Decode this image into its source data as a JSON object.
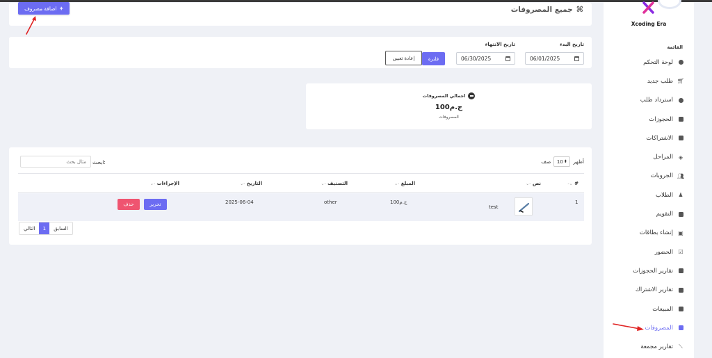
{
  "sidebar": {
    "brand_name": "Xcoding Era",
    "menu_title": "القائمة",
    "items": [
      {
        "label": "لوحة التحكم",
        "icon": "dashboard-icon"
      },
      {
        "label": "طلب جديد",
        "icon": "cart-icon"
      },
      {
        "label": "استرداد طلب",
        "icon": "refund-icon"
      },
      {
        "label": "الحجوزات",
        "icon": "book-icon"
      },
      {
        "label": "الاشتراكات",
        "icon": "calendar-icon"
      },
      {
        "label": "المراحل",
        "icon": "layers-icon"
      },
      {
        "label": "الجروبات",
        "icon": "users-icon"
      },
      {
        "label": "الطلاب",
        "icon": "student-icon"
      },
      {
        "label": "التقويم",
        "icon": "calendar-icon"
      },
      {
        "label": "إنشاء بطاقات",
        "icon": "id-card-icon"
      },
      {
        "label": "الحضور",
        "icon": "calendar-check-icon"
      },
      {
        "label": "تقارير الحجوزات",
        "icon": "book-icon"
      },
      {
        "label": "تقارير الاشتراك",
        "icon": "calendar-icon"
      },
      {
        "label": "المبيعات",
        "icon": "money-icon"
      },
      {
        "label": "المصروفات",
        "icon": "money-icon",
        "active": true
      },
      {
        "label": "تقارير مجمعة",
        "icon": "chart-line-icon"
      }
    ]
  },
  "header": {
    "title": "جميع المصروفات",
    "add_button": "اضافة مصروف"
  },
  "filter": {
    "start_label": "تاريخ البدء",
    "start_value": "06/01/2025",
    "end_label": "تاريخ الانتهاء",
    "end_value": "06/30/2025",
    "filter_button": "فلترة",
    "reset_button": "إعادة تعيين"
  },
  "summary": {
    "title": "اجمالي المصروفات",
    "value": "100ج.م",
    "caption": "المصروفات"
  },
  "table": {
    "show_label": "أظهر",
    "entries_value": "10",
    "rows_label": "صف",
    "search_label": "ابحث:",
    "search_placeholder": "مثال بحث",
    "columns": [
      "#",
      "نص",
      "المبلغ",
      "التصنيف",
      "التاريخ",
      "الإجراءات"
    ],
    "rows": [
      {
        "index": "1",
        "text": "test",
        "amount": "100ج.م",
        "category": "other",
        "date": "2025-06-04",
        "edit": "تحرير",
        "delete": "حذف"
      }
    ],
    "pagination": {
      "prev": "السابق",
      "current": "1",
      "next": "التالي"
    }
  },
  "colors": {
    "accent": "#6c6cf2",
    "danger": "#ef5470",
    "arrow": "#e02424"
  }
}
